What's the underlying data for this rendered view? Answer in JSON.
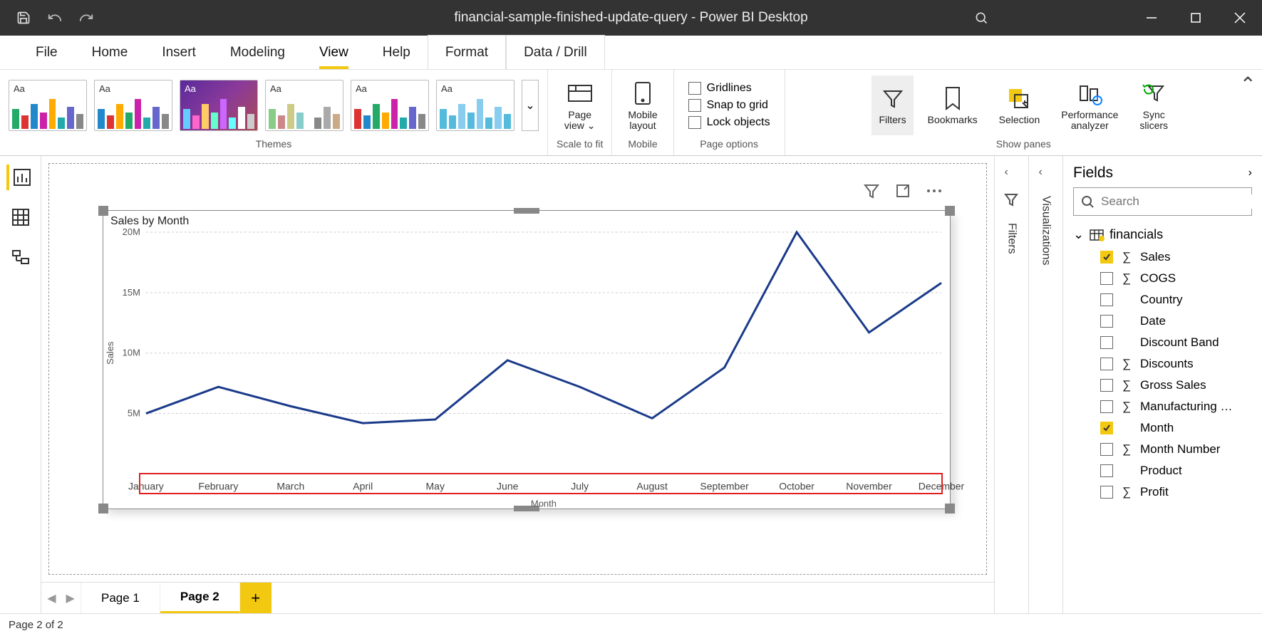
{
  "title": "financial-sample-finished-update-query - Power BI Desktop",
  "menu": [
    "File",
    "Home",
    "Insert",
    "Modeling",
    "View",
    "Help",
    "Format",
    "Data / Drill"
  ],
  "menu_active": "View",
  "menu_boxed": [
    "Format",
    "Data / Drill"
  ],
  "ribbon": {
    "themes_label": "Themes",
    "scale_label": "Scale to fit",
    "mobile_label": "Mobile",
    "pageopts_label": "Page options",
    "showpanes_label": "Show panes",
    "page_view": "Page\nview",
    "mobile_layout": "Mobile\nlayout",
    "opts": {
      "gridlines": "Gridlines",
      "snap": "Snap to grid",
      "lock": "Lock objects"
    },
    "panes": {
      "filters": "Filters",
      "bookmarks": "Bookmarks",
      "selection": "Selection",
      "perf": "Performance\nanalyzer",
      "sync": "Sync\nslicers"
    }
  },
  "pages": {
    "p1": "Page 1",
    "p2": "Page 2"
  },
  "status": "Page 2 of 2",
  "collapsed_panes": {
    "filters": "Filters",
    "viz": "Visualizations"
  },
  "fields": {
    "title": "Fields",
    "search_placeholder": "Search",
    "table": "financials",
    "items": [
      {
        "label": "Sales",
        "sigma": true,
        "checked": true
      },
      {
        "label": "COGS",
        "sigma": true,
        "checked": false
      },
      {
        "label": "Country",
        "sigma": false,
        "checked": false
      },
      {
        "label": "Date",
        "sigma": false,
        "checked": false
      },
      {
        "label": "Discount Band",
        "sigma": false,
        "checked": false
      },
      {
        "label": "Discounts",
        "sigma": true,
        "checked": false
      },
      {
        "label": "Gross Sales",
        "sigma": true,
        "checked": false
      },
      {
        "label": "Manufacturing …",
        "sigma": true,
        "checked": false
      },
      {
        "label": "Month",
        "sigma": false,
        "checked": true
      },
      {
        "label": "Month Number",
        "sigma": true,
        "checked": false
      },
      {
        "label": "Product",
        "sigma": false,
        "checked": false
      },
      {
        "label": "Profit",
        "sigma": true,
        "checked": false
      }
    ]
  },
  "chart_data": {
    "type": "line",
    "title": "Sales by Month",
    "xlabel": "Month",
    "ylabel": "Sales",
    "categories": [
      "January",
      "February",
      "March",
      "April",
      "May",
      "June",
      "July",
      "August",
      "September",
      "October",
      "November",
      "December"
    ],
    "values": [
      5000000,
      7200000,
      5600000,
      4200000,
      4500000,
      9400000,
      7200000,
      4600000,
      8800000,
      20000000,
      11700000,
      15800000
    ],
    "ylim": [
      0,
      20000000
    ],
    "yticks": [
      5000000,
      10000000,
      15000000,
      20000000
    ],
    "ytick_labels": [
      "5M",
      "10M",
      "15M",
      "20M"
    ]
  }
}
